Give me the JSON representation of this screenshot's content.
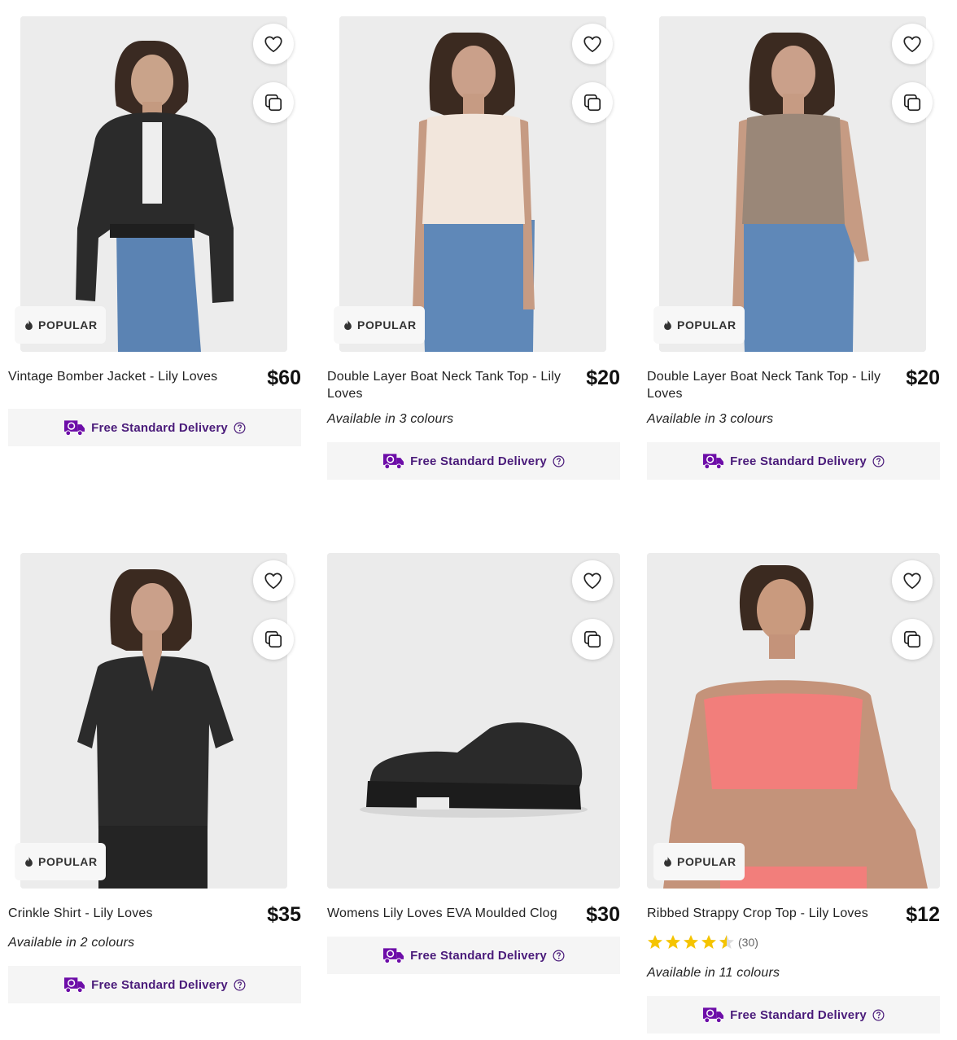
{
  "products": [
    {
      "name": "Vintage Bomber Jacket - Lily Loves",
      "price": "$60",
      "badge": "POPULAR",
      "colours": "",
      "delivery": "Free Standard Delivery",
      "image": "woman-leather-bomber-jacket"
    },
    {
      "name": "Double Layer Boat Neck Tank Top - Lily Loves",
      "price": "$20",
      "badge": "POPULAR",
      "colours": "Available in 3 colours",
      "delivery": "Free Standard Delivery",
      "image": "woman-cream-tank-top"
    },
    {
      "name": "Double Layer Boat Neck Tank Top - Lily Loves",
      "price": "$20",
      "badge": "POPULAR",
      "colours": "Available in 3 colours",
      "delivery": "Free Standard Delivery",
      "image": "woman-taupe-tank-top"
    },
    {
      "name": "Crinkle Shirt - Lily Loves",
      "price": "$35",
      "badge": "POPULAR",
      "colours": "Available in 2 colours",
      "delivery": "Free Standard Delivery",
      "image": "woman-black-crinkle-shirt"
    },
    {
      "name": "Womens Lily Loves EVA Moulded Clog",
      "price": "$30",
      "badge": "",
      "colours": "",
      "delivery": "Free Standard Delivery",
      "image": "black-platform-clog"
    },
    {
      "name": "Ribbed Strappy Crop Top - Lily Loves",
      "price": "$12",
      "badge": "POPULAR",
      "rating": {
        "stars": 4.5,
        "count": "(30)"
      },
      "colours": "Available in 11 colours",
      "delivery": "Free Standard Delivery",
      "image": "woman-pink-crop-top"
    }
  ],
  "icons": {
    "wishlist": "heart-outline-icon",
    "compare": "copy-stack-icon",
    "popular": "flame-icon",
    "delivery": "delivery-truck-icon",
    "help": "question-circle-icon",
    "star": "star-icon"
  },
  "colors": {
    "delivery_text": "#4a1b7a",
    "delivery_icon": "#6d0da8",
    "delivery_bg": "#f5f5f5",
    "star": "#f5c400",
    "badge_bg": "#f7f7f7"
  }
}
